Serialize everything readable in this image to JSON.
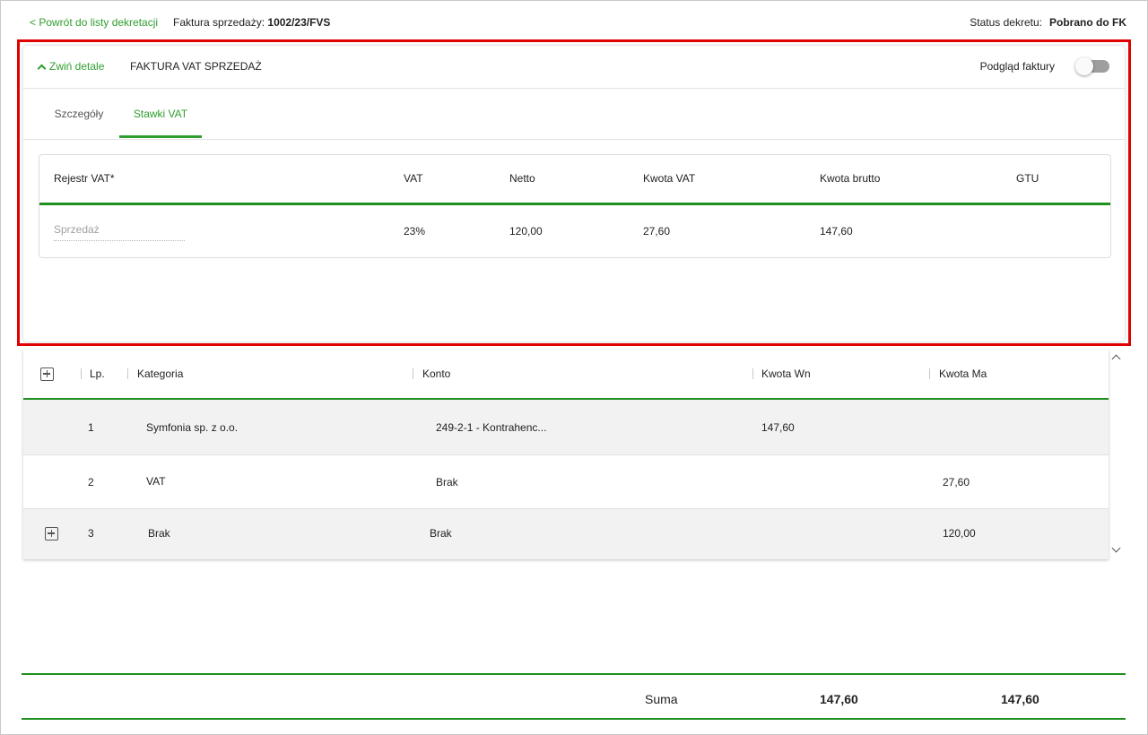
{
  "topbar": {
    "back_label": "< Powrót do listy dekretacji",
    "invoice_prefix": "Faktura sprzedaży:",
    "invoice_number": "1002/23/FVS",
    "status_label": "Status dekretu:",
    "status_value": "Pobrano do FK"
  },
  "details": {
    "collapse_label": "Zwiń detale",
    "title": "FAKTURA VAT SPRZEDAŻ",
    "preview_label": "Podgląd faktury",
    "preview_on": false,
    "tabs": [
      {
        "label": "Szczegóły",
        "active": false
      },
      {
        "label": "Stawki VAT",
        "active": true
      }
    ],
    "vat_table": {
      "headers": [
        "Rejestr VAT*",
        "VAT",
        "Netto",
        "Kwota VAT",
        "Kwota brutto",
        "GTU"
      ],
      "rows": [
        {
          "rejestr_placeholder": "Sprzedaż",
          "vat": "23%",
          "netto": "120,00",
          "kwota_vat": "27,60",
          "kwota_brutto": "147,60",
          "gtu": ""
        }
      ]
    }
  },
  "decree": {
    "headers": [
      "Lp.",
      "Kategoria",
      "Konto",
      "Kwota Wn",
      "Kwota Ma"
    ],
    "rows": [
      {
        "lp": "1",
        "kategoria": "Symfonia sp. z o.o.",
        "konto": "249-2-1 - Kontrahenc...",
        "wn": "147,60",
        "ma": ""
      },
      {
        "lp": "2",
        "kategoria": "VAT",
        "konto": "Brak",
        "wn": "",
        "ma": "27,60"
      },
      {
        "lp": "3",
        "kategoria": "Brak",
        "konto": "Brak",
        "wn": "",
        "ma": "120,00"
      }
    ]
  },
  "summary": {
    "label": "Suma",
    "wn": "147,60",
    "ma": "147,60"
  },
  "colors": {
    "accent": "#2e9e2e",
    "rule": "#1f8f1f",
    "highlight": "#e00000"
  }
}
